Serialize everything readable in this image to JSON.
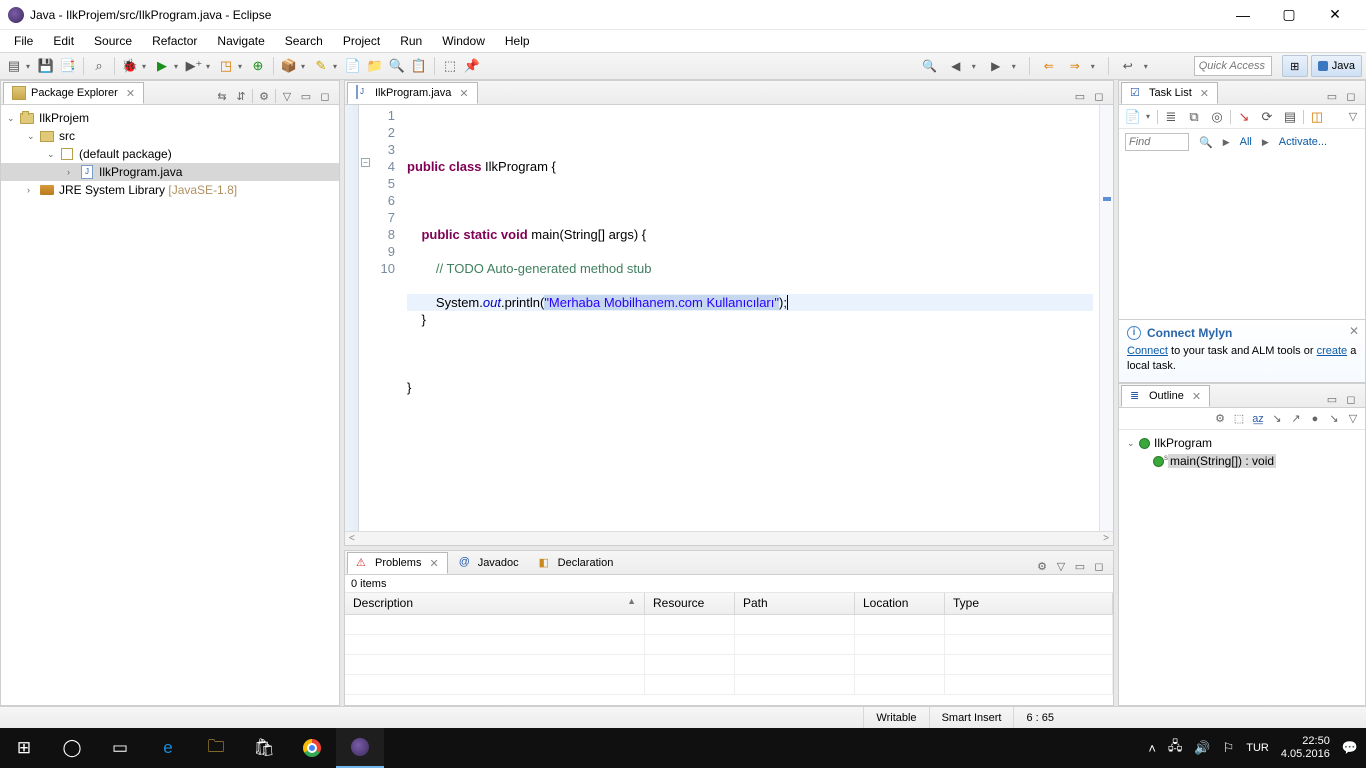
{
  "window": {
    "title": "Java - IlkProjem/src/IlkProgram.java - Eclipse"
  },
  "menubar": [
    "File",
    "Edit",
    "Source",
    "Refactor",
    "Navigate",
    "Search",
    "Project",
    "Run",
    "Window",
    "Help"
  ],
  "toolbar": {
    "quick_access_placeholder": "Quick Access",
    "perspective_label": "Java"
  },
  "package_explorer": {
    "title": "Package Explorer",
    "tree": {
      "project": "IlkProjem",
      "src": "src",
      "default_pkg": "(default package)",
      "file": "IlkProgram.java",
      "jre": "JRE System Library",
      "jre_ver": "[JavaSE-1.8]"
    }
  },
  "editor": {
    "tab": "IlkProgram.java",
    "lines": [
      "1",
      "2",
      "3",
      "4",
      "5",
      "6",
      "7",
      "8",
      "9",
      "10"
    ],
    "code": {
      "l2_a": "public",
      "l2_b": " class",
      "l2_c": " IlkProgram {",
      "l4_a": "public",
      "l4_b": " static",
      "l4_c": " void",
      "l4_d": " main(String[] args) {",
      "l5": "// TODO Auto-generated method stub",
      "l6_a": "System.",
      "l6_b": "out",
      "l6_c": ".println(",
      "l6_str": "\"Merhaba Mobilhanem.com Kullanıcıları\"",
      "l6_d": ");",
      "l7": "}",
      "l9": "}"
    },
    "hscroll_left": "<",
    "hscroll_right": ">"
  },
  "tasklist": {
    "title": "Task List",
    "find_placeholder": "Find",
    "all": "All",
    "activate": "Activate..."
  },
  "mylyn": {
    "title": "Connect Mylyn",
    "link_connect": "Connect",
    "text1": " to your task and ALM tools or ",
    "link_create": "create",
    "text2": " a local task."
  },
  "outline": {
    "title": "Outline",
    "class": "IlkProgram",
    "method": "main(String[]) : void"
  },
  "problems": {
    "tab_problems": "Problems",
    "tab_javadoc": "Javadoc",
    "tab_declaration": "Declaration",
    "items": "0 items",
    "cols": [
      "Description",
      "Resource",
      "Path",
      "Location",
      "Type"
    ]
  },
  "status": {
    "writable": "Writable",
    "insert": "Smart Insert",
    "pos": "6 : 65"
  },
  "taskbar": {
    "lang": "TUR",
    "time": "22:50",
    "date": "4.05.2016"
  }
}
